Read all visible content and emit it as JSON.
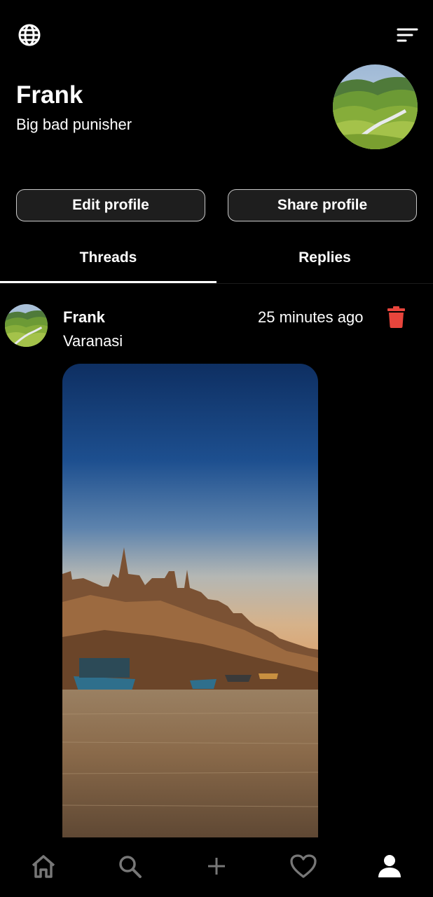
{
  "profile": {
    "name": "Frank",
    "bio": "Big bad punisher"
  },
  "actions": {
    "edit_label": "Edit profile",
    "share_label": "Share profile"
  },
  "tabs": [
    {
      "label": "Threads",
      "active": true
    },
    {
      "label": "Replies",
      "active": false
    }
  ],
  "post": {
    "author": "Frank",
    "time": "25 minutes ago",
    "text": "Varanasi"
  },
  "icons": {
    "top_left": "globe-icon",
    "top_right": "sort-menu-icon",
    "post_action": "trash-icon",
    "nav": [
      "home-icon",
      "search-icon",
      "plus-icon",
      "heart-icon",
      "person-icon"
    ]
  },
  "colors": {
    "background": "#000000",
    "text": "#ffffff",
    "delete": "#e8453c",
    "nav_inactive": "#777777"
  }
}
